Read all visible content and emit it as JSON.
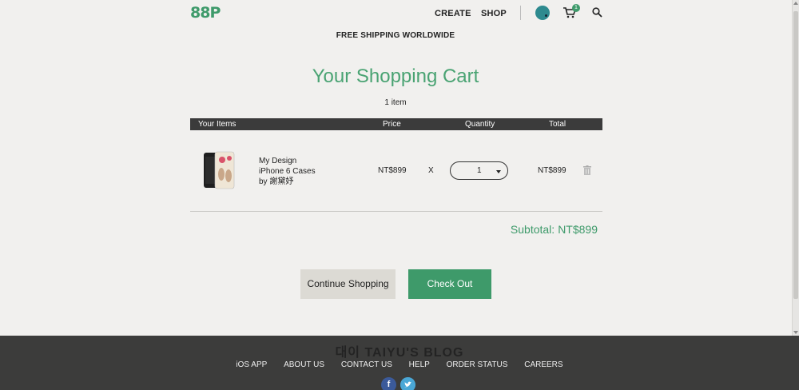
{
  "header": {
    "logo": "88P",
    "nav": {
      "create": "CREATE",
      "shop": "SHOP"
    },
    "cart_badge": "1"
  },
  "banner": {
    "free_shipping": "FREE SHIPPING WORLDWIDE"
  },
  "cart": {
    "title": "Your Shopping Cart",
    "item_count": "1 item",
    "columns": {
      "items": "Your Items",
      "price": "Price",
      "quantity": "Quantity",
      "total": "Total"
    },
    "rows": [
      {
        "name_line1": "My Design",
        "name_line2": "iPhone 6 Cases",
        "name_line3": "by 謝黛妤",
        "price": "NT$899",
        "multiplier": "X",
        "quantity": "1",
        "total": "NT$899"
      }
    ],
    "subtotal_label": "Subtotal:",
    "subtotal_value": "NT$899"
  },
  "actions": {
    "continue": "Continue Shopping",
    "checkout": "Check Out"
  },
  "footer": {
    "watermark": "대이 TAIYU'S BLOG",
    "links": [
      "iOS APP",
      "ABOUT US",
      "CONTACT US",
      "HELP",
      "ORDER STATUS",
      "CAREERS"
    ],
    "facebook": "f"
  },
  "colors": {
    "brand_green": "#3e9a6a",
    "header_bar": "#3b3b3b",
    "footer_bg": "#3c3c3b"
  }
}
